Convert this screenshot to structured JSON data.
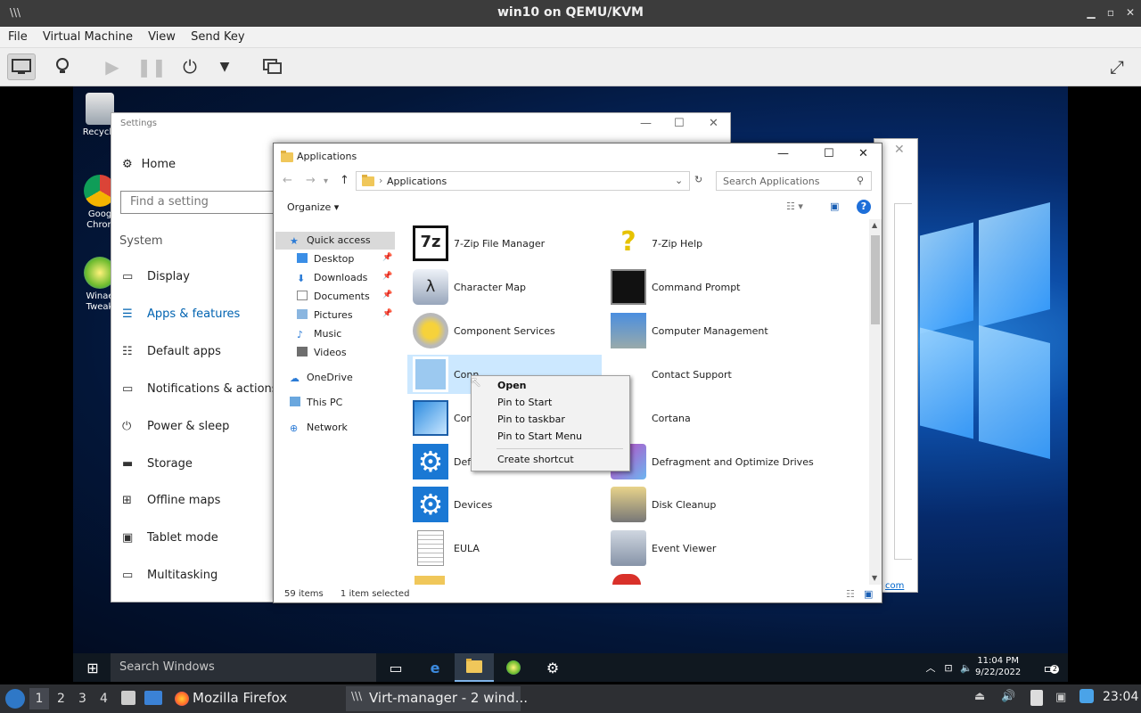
{
  "host": {
    "window_title": "win10 on QEMU/KVM",
    "menu": [
      "File",
      "Virtual Machine",
      "View",
      "Send Key"
    ],
    "toolbar_icons": [
      "monitor-icon",
      "lightbulb-icon",
      "play-icon",
      "pause-icon",
      "power-icon",
      "dropdown-icon",
      "screenshot-icon",
      "fullscreen-icon"
    ]
  },
  "desktop": {
    "icons": [
      {
        "label": "Recycle",
        "icon": "recycle-bin-icon"
      },
      {
        "label": "Goog Chron",
        "icon": "chrome-icon"
      },
      {
        "label": "Winae Tweak",
        "icon": "winaero-tweaker-icon"
      }
    ]
  },
  "settings": {
    "title": "Settings",
    "home": "Home",
    "search_placeholder": "Find a setting",
    "section": "System",
    "nav": [
      {
        "label": "Display",
        "icon": "display-icon"
      },
      {
        "label": "Apps & features",
        "icon": "apps-features-icon",
        "selected": true
      },
      {
        "label": "Default apps",
        "icon": "default-apps-icon"
      },
      {
        "label": "Notifications & actions",
        "icon": "notifications-icon"
      },
      {
        "label": "Power & sleep",
        "icon": "power-icon"
      },
      {
        "label": "Storage",
        "icon": "storage-icon"
      },
      {
        "label": "Offline maps",
        "icon": "offline-maps-icon"
      },
      {
        "label": "Tablet mode",
        "icon": "tablet-mode-icon"
      },
      {
        "label": "Multitasking",
        "icon": "multitasking-icon"
      }
    ]
  },
  "backwin": {
    "link_text": "com"
  },
  "explorer": {
    "title": "Applications",
    "address": "Applications",
    "address_sep": "›",
    "search_placeholder": "Search Applications",
    "organize": "Organize ▾",
    "nav": [
      {
        "label": "Quick access",
        "pinned": false,
        "selected": true
      },
      {
        "label": "Desktop",
        "pinned": true
      },
      {
        "label": "Downloads",
        "pinned": true
      },
      {
        "label": "Documents",
        "pinned": true
      },
      {
        "label": "Pictures",
        "pinned": true
      },
      {
        "label": "Music",
        "pinned": false
      },
      {
        "label": "Videos",
        "pinned": false
      },
      {
        "label": "OneDrive",
        "pinned": false
      },
      {
        "label": "This PC",
        "pinned": false
      },
      {
        "label": "Network",
        "pinned": false
      }
    ],
    "apps": [
      {
        "label": "7-Zip File Manager",
        "icon": "7zip-icon"
      },
      {
        "label": "7-Zip Help",
        "icon": "help-icon"
      },
      {
        "label": "Character Map",
        "icon": "character-map-icon"
      },
      {
        "label": "Command Prompt",
        "icon": "command-prompt-icon"
      },
      {
        "label": "Component Services",
        "icon": "component-services-icon"
      },
      {
        "label": "Computer Management",
        "icon": "computer-management-icon"
      },
      {
        "label": "Conn",
        "icon": "connect-icon",
        "selected": true
      },
      {
        "label": "Contact Support",
        "icon": "contact-support-icon"
      },
      {
        "label": "Con",
        "icon": "control-panel-icon"
      },
      {
        "label": "Cortana",
        "icon": "cortana-icon"
      },
      {
        "label": "Defa",
        "icon": "default-apps-gear-icon"
      },
      {
        "label": "Defragment and Optimize Drives",
        "icon": "defragment-icon"
      },
      {
        "label": "Devices",
        "icon": "devices-gear-icon"
      },
      {
        "label": "Disk Cleanup",
        "icon": "disk-cleanup-icon"
      },
      {
        "label": "EULA",
        "icon": "document-icon"
      },
      {
        "label": "Event Viewer",
        "icon": "event-viewer-icon"
      }
    ],
    "status_count": "59 items",
    "status_selected": "1 item selected"
  },
  "context_menu": {
    "items": [
      "Open",
      "Pin to Start",
      "Pin to taskbar",
      "Pin to Start Menu",
      "Create shortcut"
    ]
  },
  "win_taskbar": {
    "search_placeholder": "Search Windows",
    "time": "11:04 PM",
    "date": "9/22/2022",
    "notification_count": "2"
  },
  "host_panel": {
    "workspaces": [
      "1",
      "2",
      "3",
      "4"
    ],
    "tasks": [
      {
        "label": "Mozilla Firefox",
        "icon": "firefox-icon"
      },
      {
        "label": "Virt-manager - 2 wind...",
        "icon": "virt-manager-icon"
      }
    ],
    "clock": "23:04"
  }
}
